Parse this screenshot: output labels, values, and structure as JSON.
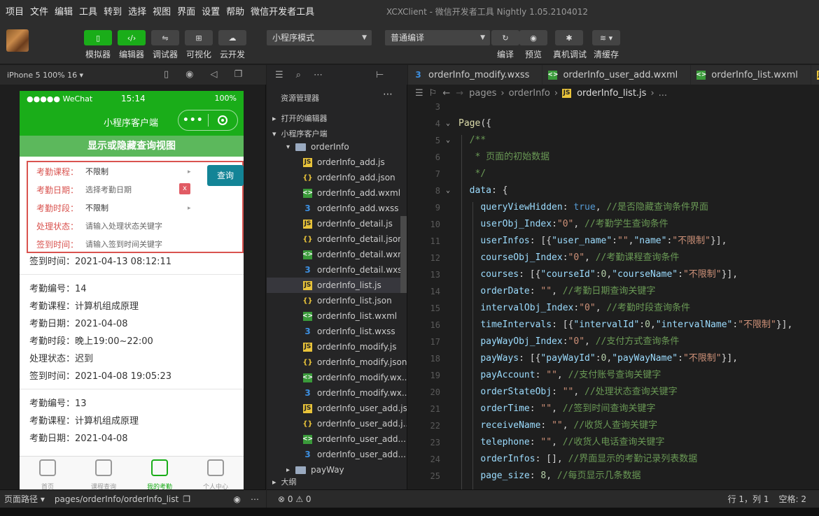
{
  "menu": {
    "items": [
      "项目",
      "文件",
      "编辑",
      "工具",
      "转到",
      "选择",
      "视图",
      "界面",
      "设置",
      "帮助",
      "微信开发者工具"
    ],
    "window_title": "XCXClient - 微信开发者工具 Nightly 1.05.2104012"
  },
  "toolbar": {
    "simulator": "模拟器",
    "editor": "编辑器",
    "debugger": "调试器",
    "visual": "可视化",
    "cloud": "云开发",
    "mode_select": "小程序模式",
    "compile_select": "普通编译",
    "compile": "编译",
    "preview": "预览",
    "device_debug": "真机调试",
    "clear_cache": "清缓存"
  },
  "simulator": {
    "device": "iPhone 5 100% 16 ▾",
    "status_left": "●●●●● WeChat",
    "status_time": "15:14",
    "status_battery": "100%",
    "nav_title": "小程序客户端",
    "toggle_label": "显示或隐藏查询视图",
    "query": {
      "course_label": "考勤课程：",
      "course_value": "不限制",
      "date_label": "考勤日期：",
      "date_value": "选择考勤日期",
      "interval_label": "考勤时段：",
      "interval_value": "不限制",
      "state_label": "处理状态：",
      "state_value": "请输入处理状态关键字",
      "time_label": "签到时间：",
      "time_value": "请输入签到时间关键字",
      "query_button": "查询",
      "clear_button": "x"
    },
    "records": [
      [
        "签到时间：2021-04-13 08:12:11"
      ],
      [
        "考勤编号：14",
        "考勤课程：计算机组成原理",
        "考勤日期：2021-04-08",
        "考勤时段：晚上19:00~22:00",
        "处理状态：迟到",
        "签到时间：2021-04-08 19:05:23"
      ],
      [
        "考勤编号：13",
        "考勤课程：计算机组成原理",
        "考勤日期：2021-04-08"
      ]
    ],
    "tabs": [
      "首页",
      "课程查询",
      "我的考勤",
      "个人中心"
    ]
  },
  "explorer": {
    "title": "资源管理器",
    "open_editors": "打开的编辑器",
    "project": "小程序客户端",
    "outline": "大纲",
    "tree": [
      {
        "type": "folder",
        "name": "orderInfo"
      },
      {
        "type": "js",
        "name": "orderInfo_add.js"
      },
      {
        "type": "json",
        "name": "orderInfo_add.json"
      },
      {
        "type": "wxml",
        "name": "orderInfo_add.wxml"
      },
      {
        "type": "wxss",
        "name": "orderInfo_add.wxss"
      },
      {
        "type": "js",
        "name": "orderInfo_detail.js"
      },
      {
        "type": "json",
        "name": "orderInfo_detail.json"
      },
      {
        "type": "wxml",
        "name": "orderInfo_detail.wxml"
      },
      {
        "type": "wxss",
        "name": "orderInfo_detail.wxss"
      },
      {
        "type": "js",
        "name": "orderInfo_list.js"
      },
      {
        "type": "json",
        "name": "orderInfo_list.json"
      },
      {
        "type": "wxml",
        "name": "orderInfo_list.wxml"
      },
      {
        "type": "wxss",
        "name": "orderInfo_list.wxss"
      },
      {
        "type": "js",
        "name": "orderInfo_modify.js"
      },
      {
        "type": "json",
        "name": "orderInfo_modify.json"
      },
      {
        "type": "wxml",
        "name": "orderInfo_modify.wx..."
      },
      {
        "type": "wxss",
        "name": "orderInfo_modify.wx..."
      },
      {
        "type": "js",
        "name": "orderInfo_user_add.js"
      },
      {
        "type": "json",
        "name": "orderInfo_user_add.j..."
      },
      {
        "type": "wxml",
        "name": "orderInfo_user_add...."
      },
      {
        "type": "wxss",
        "name": "orderInfo_user_add...."
      },
      {
        "type": "folder",
        "name": "payWay"
      }
    ]
  },
  "editor": {
    "tabs": [
      "orderInfo_modify.wxss",
      "orderInfo_user_add.wxml",
      "orderInfo_list.wxml"
    ],
    "breadcrumb": [
      "pages",
      "orderInfo",
      "orderInfo_list.js",
      "..."
    ],
    "lines": [
      {
        "n": "3",
        "code": ""
      },
      {
        "n": "4",
        "code": "Page({"
      },
      {
        "n": "5",
        "code": "  /**"
      },
      {
        "n": "6",
        "code": "   * 页面的初始数据"
      },
      {
        "n": "7",
        "code": "   */"
      },
      {
        "n": "8",
        "code": "  data: {"
      },
      {
        "n": "9",
        "code": "    queryViewHidden: true, //是否隐藏查询条件界面"
      },
      {
        "n": "10",
        "code": "    userObj_Index:\"0\", //考勤学生查询条件"
      },
      {
        "n": "11",
        "code": "    userInfos: [{\"user_name\":\"\",\"name\":\"不限制\"}],"
      },
      {
        "n": "12",
        "code": "    courseObj_Index:\"0\", //考勤课程查询条件"
      },
      {
        "n": "13",
        "code": "    courses: [{\"courseId\":0,\"courseName\":\"不限制\"}],"
      },
      {
        "n": "14",
        "code": "    orderDate: \"\", //考勤日期查询关键字"
      },
      {
        "n": "15",
        "code": "    intervalObj_Index:\"0\", //考勤时段查询条件"
      },
      {
        "n": "16",
        "code": "    timeIntervals: [{\"intervalId\":0,\"intervalName\":\"不限制\"}],"
      },
      {
        "n": "17",
        "code": "    payWayObj_Index:\"0\", //支付方式查询条件"
      },
      {
        "n": "18",
        "code": "    payWays: [{\"payWayId\":0,\"payWayName\":\"不限制\"}],"
      },
      {
        "n": "19",
        "code": "    payAccount: \"\", //支付账号查询关键字"
      },
      {
        "n": "20",
        "code": "    orderStateObj: \"\", //处理状态查询关键字"
      },
      {
        "n": "21",
        "code": "    orderTime: \"\", //签到时间查询关键字"
      },
      {
        "n": "22",
        "code": "    receiveName: \"\", //收货人查询关键字"
      },
      {
        "n": "23",
        "code": "    telephone: \"\", //收货人电话查询关键字"
      },
      {
        "n": "24",
        "code": "    orderInfos: [], //界面显示的考勤记录列表数据"
      },
      {
        "n": "25",
        "code": "    page_size: 8, //每页显示几条数据"
      }
    ]
  },
  "status": {
    "page_path_label": "页面路径 ▾",
    "page_path": "pages/orderInfo/orderInfo_list",
    "problems": "⊗ 0 ⚠ 0",
    "cursor": "行 1，列 1",
    "indent": "空格: 2"
  },
  "colors": {
    "wechat_green": "#1aad19",
    "query_red": "#d9534f",
    "query_button": "#138496"
  }
}
